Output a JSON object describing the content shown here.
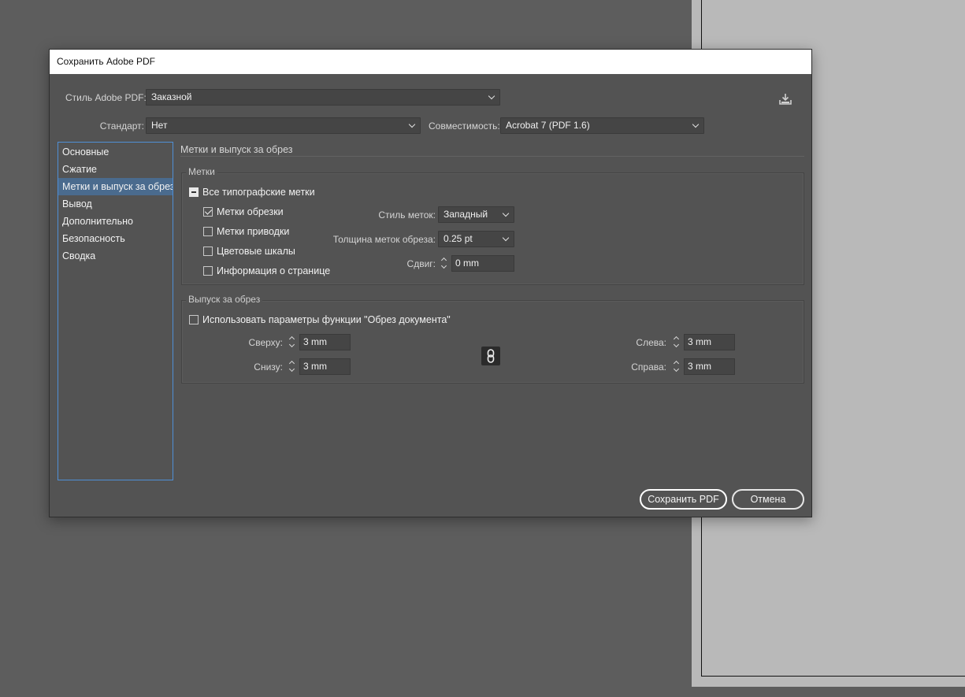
{
  "dialog": {
    "title": "Сохранить Adobe PDF",
    "preset": {
      "label": "Стиль Adobe PDF:",
      "value": "Заказной"
    },
    "standard": {
      "label": "Стандарт:",
      "value": "Нет"
    },
    "compatibility": {
      "label": "Совместимость:",
      "value": "Acrobat 7 (PDF 1.6)"
    },
    "icons": {
      "save_preset": "save-preset-icon",
      "link": "link-icon"
    }
  },
  "sidebar": {
    "items": [
      {
        "label": "Основные",
        "active": false
      },
      {
        "label": "Сжатие",
        "active": false
      },
      {
        "label": "Метки и выпуск за обрез",
        "active": true
      },
      {
        "label": "Вывод",
        "active": false
      },
      {
        "label": "Дополнительно",
        "active": false
      },
      {
        "label": "Безопасность",
        "active": false
      },
      {
        "label": "Сводка",
        "active": false
      }
    ]
  },
  "panel": {
    "title": "Метки и выпуск за обрез",
    "marks": {
      "legend": "Метки",
      "all_marks": {
        "label": "Все типографские метки",
        "state": "mixed"
      },
      "crop_marks": {
        "label": "Метки обрезки",
        "checked": true
      },
      "registration_marks": {
        "label": "Метки приводки",
        "checked": false
      },
      "color_bars": {
        "label": "Цветовые шкалы",
        "checked": false
      },
      "page_info": {
        "label": "Информация о странице",
        "checked": false
      },
      "type": {
        "label": "Стиль меток:",
        "value": "Западный"
      },
      "weight": {
        "label": "Толщина меток обреза:",
        "value": "0.25 pt"
      },
      "offset": {
        "label": "Сдвиг:",
        "value": "0 mm"
      }
    },
    "bleed": {
      "legend": "Выпуск за обрез",
      "use_doc": {
        "label": "Использовать параметры функции \"Обрез документа\"",
        "checked": false
      },
      "top": {
        "label": "Сверху:",
        "value": "3 mm"
      },
      "bottom": {
        "label": "Снизу:",
        "value": "3 mm"
      },
      "left": {
        "label": "Слева:",
        "value": "3 mm"
      },
      "right": {
        "label": "Справа:",
        "value": "3 mm"
      }
    }
  },
  "buttons": {
    "save": "Сохранить PDF",
    "cancel": "Отмена"
  },
  "colors": {
    "canvas": "#5d5d5d",
    "dialog": "#535353",
    "accent": "#4f8fd6",
    "selected": "#4a6b8e"
  }
}
